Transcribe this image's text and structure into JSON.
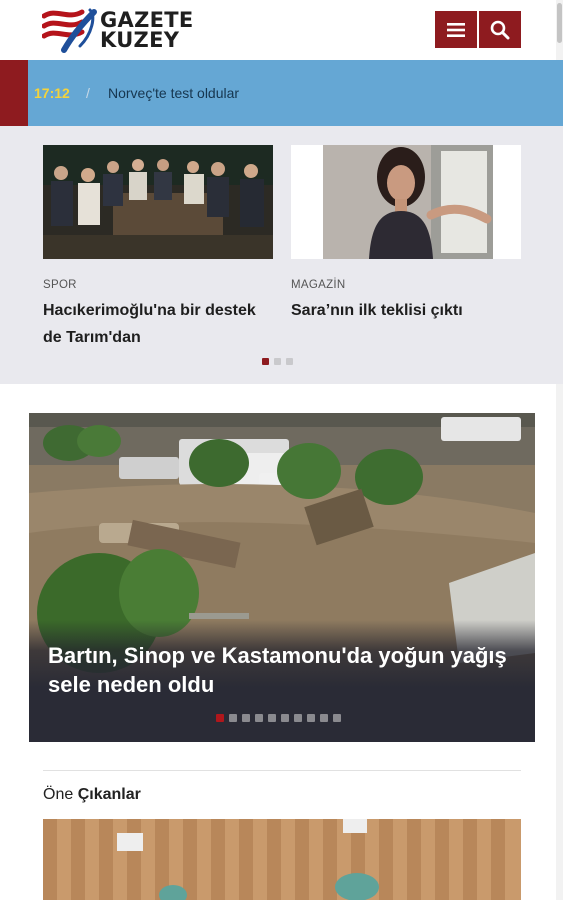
{
  "header": {
    "logo_line1": "GAZETE",
    "logo_line2": "KUZEY",
    "menu_icon": "hamburger-menu-icon",
    "search_icon": "search-icon"
  },
  "ticker": {
    "time": "17:12",
    "separator": "/",
    "headline": "Norveç'te test oldular"
  },
  "top_slider": {
    "cards": [
      {
        "category": "SPOR",
        "title": "Hacıkerimoğlu'na bir destek de Tarım'dan"
      },
      {
        "category": "MAGAZİN",
        "title": "Sara’nın ilk teklisi çıktı"
      }
    ],
    "active_page": 1,
    "page_count": 3
  },
  "hero": {
    "title": "Bartın, Sinop ve Kastamonu'da yoğun yağış sele neden oldu",
    "active_page": 1,
    "page_count": 10
  },
  "featured": {
    "title_light": "Öne",
    "title_bold": "Çıkanlar"
  },
  "colors": {
    "brand": "#8e1b1f",
    "ticker_bg": "#65a7d4",
    "ticker_time": "#f4d33b"
  }
}
